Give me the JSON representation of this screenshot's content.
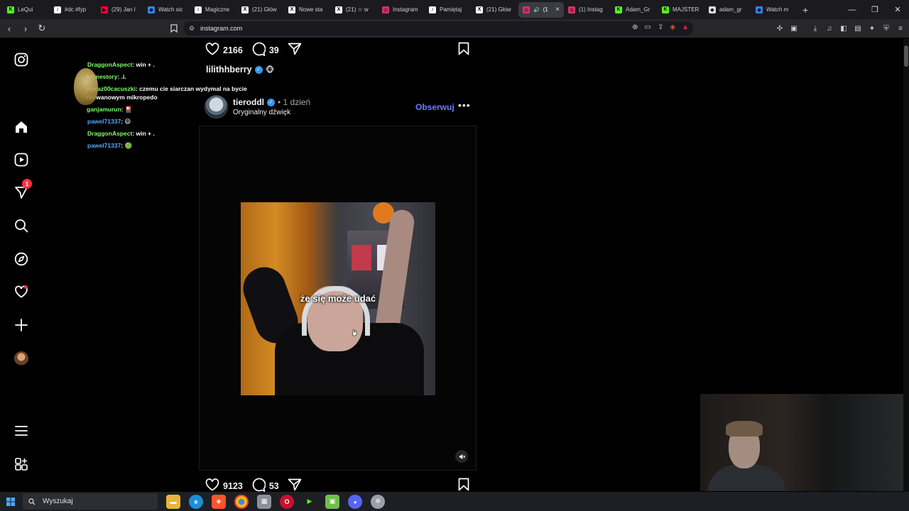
{
  "browser": {
    "tabs": [
      {
        "label": "LeQui",
        "fav_color": "#53fc18",
        "fav_text": "K"
      },
      {
        "label": "#dc #fyp",
        "fav_color": "#ffffff",
        "fav_text": "♪"
      },
      {
        "label": "(29) Jan I",
        "fav_color": "#ff0033",
        "fav_text": "▶"
      },
      {
        "label": "Watch sic",
        "fav_color": "#3b82f6",
        "fav_text": "◉"
      },
      {
        "label": "Magiczne",
        "fav_color": "#ffffff",
        "fav_text": "♪"
      },
      {
        "label": "(21) Głów",
        "fav_color": "#ffffff",
        "fav_text": "X"
      },
      {
        "label": "Nowe sta",
        "fav_color": "#ffffff",
        "fav_text": "X"
      },
      {
        "label": "(21) ☆ w",
        "fav_color": "#ffffff",
        "fav_text": "X"
      },
      {
        "label": "Instagram",
        "fav_color": "#e1306c",
        "fav_text": "◎"
      },
      {
        "label": "Pamiętaj",
        "fav_color": "#ffffff",
        "fav_text": "♪"
      },
      {
        "label": "(21) Głów",
        "fav_color": "#ffffff",
        "fav_text": "X"
      },
      {
        "label": "(1",
        "fav_color": "#e1306c",
        "fav_text": "◎",
        "active": true
      },
      {
        "label": "(1) Instag",
        "fav_color": "#e1306c",
        "fav_text": "◎"
      },
      {
        "label": "Adam_Gr",
        "fav_color": "#53fc18",
        "fav_text": "K"
      },
      {
        "label": "MAJSTER",
        "fav_color": "#53fc18",
        "fav_text": "K"
      },
      {
        "label": "adam_gr",
        "fav_color": "#dddddd",
        "fav_text": "◆"
      },
      {
        "label": "Watch m",
        "fav_color": "#3b82f6",
        "fav_text": "◉"
      }
    ],
    "new_tab": "+",
    "url": "instagram.com"
  },
  "chat": [
    {
      "user": "DraggonAspect",
      "user_class": "u-green",
      "text": ": win + ."
    },
    {
      "user": "krimestory",
      "user_class": "u-green",
      "text": ": .i."
    },
    {
      "user": "nokaz00cacuszki",
      "user_class": "u-green",
      "text": ": czemu cie siarczan wydymal na bycie"
    },
    {
      "user": "",
      "user_class": "u-green",
      "text": "rydwanowym mikropedo"
    },
    {
      "user": "ganjamurun",
      "user_class": "u-green",
      "text": ": 🎴"
    },
    {
      "user": "pawel71337",
      "user_class": "u-blue",
      "text": ": 😄"
    },
    {
      "user": "DraggonAspect",
      "user_class": "u-green",
      "text": ": win + ."
    },
    {
      "user": "pawel71337",
      "user_class": "u-blue",
      "text": ": 🟢"
    }
  ],
  "feed": {
    "prev_post": {
      "likes": "2166",
      "comments": "39",
      "liker": "lilithhberry",
      "liker_emoji": "🐵"
    },
    "post": {
      "username": "tieroddl",
      "time": "• 1 dzień",
      "audio": "Oryginalny dźwięk",
      "follow_label": "Obserwuj",
      "more": "•••",
      "caption": "że się może udać",
      "likes": "9123",
      "comments": "53"
    }
  },
  "rail": {
    "notification_count": "1"
  },
  "taskbar": {
    "search_label": "Wyszukaj"
  }
}
